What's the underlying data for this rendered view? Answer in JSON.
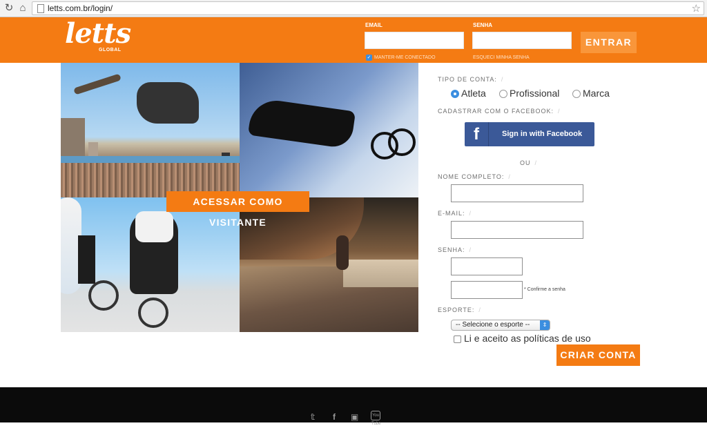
{
  "browser": {
    "url": "letts.com.br/login/"
  },
  "header": {
    "logo_text": "letts",
    "logo_sub": "GLOBAL",
    "email_label": "EMAIL",
    "senha_label": "SENHA",
    "keep_logged": "MANTER-ME CONECTADO",
    "forgot_password": "ESQUECI MINHA SENHA",
    "login_button": "ENTRAR",
    "accent_color": "#f47b13"
  },
  "main": {
    "visitor_button": "ACESSAR COMO VISITANTE"
  },
  "signup": {
    "account_type_label": "TIPO DE CONTA:",
    "account_types": [
      "Atleta",
      "Profissional",
      "Marca"
    ],
    "selected_type": "Atleta",
    "facebook_label": "CADASTRAR COM O FACEBOOK:",
    "facebook_button": "Sign in with Facebook",
    "or_label": "OU",
    "name_label": "NOME COMPLETO:",
    "email_label": "E-MAIL:",
    "password_label": "SENHA:",
    "confirm_note": "* Confirme a senha",
    "sport_label": "ESPORTE:",
    "sport_select": "-- Selecione o esporte --",
    "terms_label": "Li e aceito as políticas de uso",
    "submit_button": "CRIAR CONTA",
    "slash": "/"
  },
  "footer": {
    "icons": [
      "twitter-icon",
      "facebook-icon",
      "instagram-icon",
      "youtube-icon"
    ],
    "youtube_text": "You Tube"
  }
}
